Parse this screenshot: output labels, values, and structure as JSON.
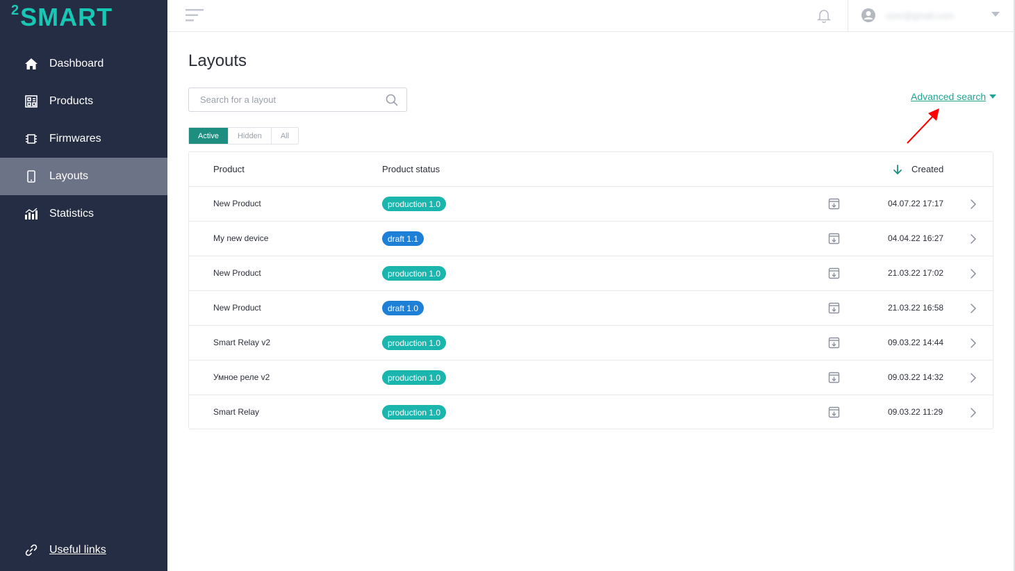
{
  "brand": {
    "sup": "2",
    "word": "SMART",
    "color": "#17c9b4"
  },
  "sidebar": {
    "items": [
      {
        "label": "Dashboard",
        "icon": "home-icon",
        "active": false
      },
      {
        "label": "Products",
        "icon": "products-icon",
        "active": false
      },
      {
        "label": "Firmwares",
        "icon": "chip-icon",
        "active": false
      },
      {
        "label": "Layouts",
        "icon": "phone-icon",
        "active": true
      },
      {
        "label": "Statistics",
        "icon": "chart-icon",
        "active": false
      }
    ],
    "useful_links": "Useful links"
  },
  "header": {
    "user_email": "user@gmail.com"
  },
  "main": {
    "title": "Layouts",
    "search": {
      "placeholder": "Search for a layout",
      "value": ""
    },
    "advanced_search": "Advanced search",
    "tabs": [
      {
        "label": "Active",
        "active": true
      },
      {
        "label": "Hidden",
        "active": false
      },
      {
        "label": "All",
        "active": false
      }
    ],
    "table": {
      "columns": {
        "product": "Product",
        "status": "Product status",
        "created": "Created"
      },
      "rows": [
        {
          "product": "New Product",
          "status": "production 1.0",
          "status_type": "production",
          "created": "04.07.22 17:17"
        },
        {
          "product": "My new device",
          "status": "draft 1.1",
          "status_type": "draft",
          "created": "04.04.22 16:27"
        },
        {
          "product": "New Product",
          "status": "production 1.0",
          "status_type": "production",
          "created": "21.03.22 17:02"
        },
        {
          "product": "New Product",
          "status": "draft 1.0",
          "status_type": "draft",
          "created": "21.03.22 16:58"
        },
        {
          "product": "Smart Relay v2",
          "status": "production 1.0",
          "status_type": "production",
          "created": "09.03.22 14:44"
        },
        {
          "product": "Умное реле v2",
          "status": "production 1.0",
          "status_type": "production",
          "created": "09.03.22 14:32"
        },
        {
          "product": "Smart Relay",
          "status": "production 1.0",
          "status_type": "production",
          "created": "09.03.22 11:29"
        }
      ]
    }
  },
  "colors": {
    "sidebar_bg": "#252d44",
    "active_nav": "#6c7386",
    "accent": "#1e8e80",
    "production": "#1ab5ad",
    "draft": "#1e7fd6",
    "annotation_arrow": "#ff0000"
  }
}
